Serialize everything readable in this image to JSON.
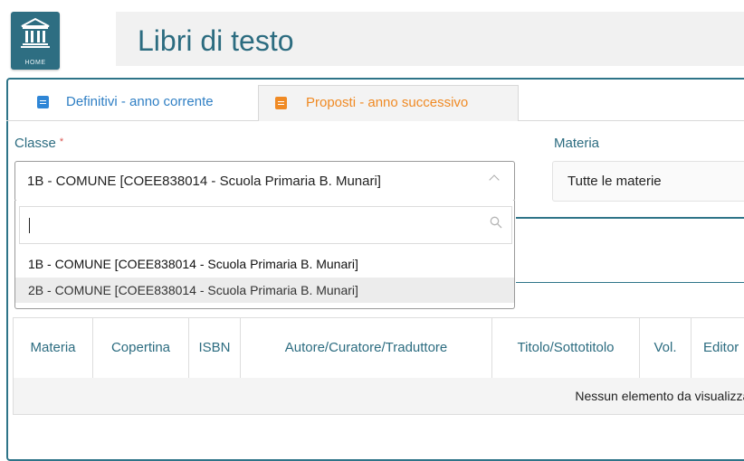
{
  "header": {
    "home_label": "HOME",
    "title": "Libri di testo"
  },
  "tabs": [
    {
      "label": "Definitivi - anno corrente",
      "icon": "book-icon",
      "color": "#2f7fc4",
      "active": false
    },
    {
      "label": "Proposti - anno successivo",
      "icon": "book-icon",
      "color": "#f08a24",
      "active": true
    }
  ],
  "filters": {
    "classe_label": "Classe",
    "required_mark": "*",
    "classe_value": "1B - COMUNE [COEE838014 - Scuola Primaria B. Munari]",
    "materia_label": "Materia",
    "materia_value": "Tutte le materie"
  },
  "dropdown": {
    "search_value": "",
    "options": [
      "1B - COMUNE [COEE838014 - Scuola Primaria B. Munari]",
      "2B - COMUNE [COEE838014 - Scuola Primaria B. Munari]"
    ],
    "highlighted_index": 1
  },
  "table": {
    "columns": [
      "Materia",
      "Copertina",
      "ISBN",
      "Autore/Curatore/Traduttore",
      "Titolo/Sottotitolo",
      "Vol.",
      "Editor"
    ],
    "empty_message": "Nessun elemento da visualizzar"
  },
  "colors": {
    "brand": "#2e7488",
    "tab_blue": "#2f7fc4",
    "tab_orange": "#f08a24",
    "required": "#d9534f"
  }
}
